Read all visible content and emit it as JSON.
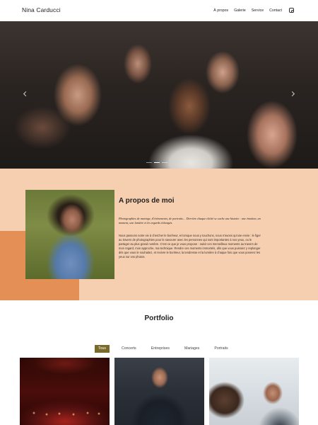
{
  "header": {
    "brand": "Nina Carducci",
    "nav": [
      "À propos",
      "Galerie",
      "Service",
      "Contact"
    ],
    "instagram_icon": "instagram-icon"
  },
  "hero": {
    "carousel_indicators": 3,
    "active_indicator": 1
  },
  "about": {
    "title": "A propos de moi",
    "intro": "Photographies de mariage, d'événements, de portraits… Derrière chaque cliché se cache une histoire : une émotion, un moment, une lumière et les regards échangés.",
    "body": "Nous passons notre vie à chercher le bonheur, et lorsque nous y touchons, nous n'avons qu'une envie : le figer au travers de photographies pour le savourer avec les personnes qui sont importantes à nos yeux, ou le partager au plus grand nombre. C'est ce que je vous propose : saisir ces merveilleux moments au travers de mon regard, mon approche, ma technique. Rendre ces moments immortels, afin que vous puissiez y replonger dès que vous le souhaitez, et revivre le bonheur, la tendresse et la lumière à chaque fois que vous poserez les yeux sur vos photos.",
    "colors": {
      "background": "#f6cfb1",
      "accent": "#e38f55"
    }
  },
  "portfolio": {
    "title": "Portfolio",
    "filters": [
      "Tous",
      "Concerts",
      "Entreprises",
      "Mariages",
      "Portraits"
    ],
    "active_filter": "Tous",
    "active_color": "#7a6a2a"
  }
}
